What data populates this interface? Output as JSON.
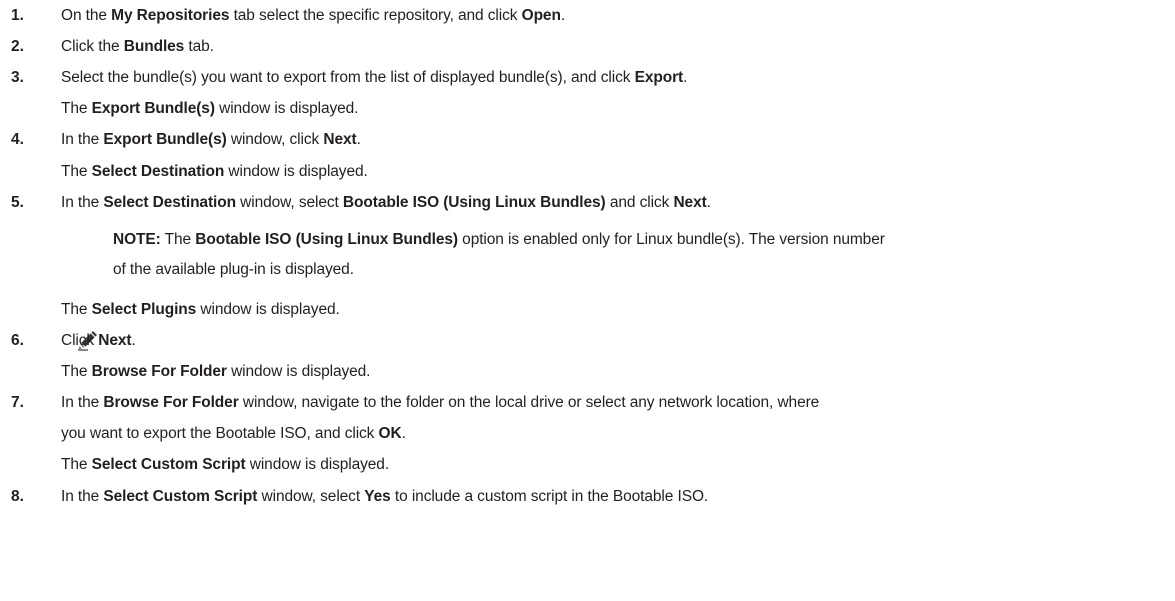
{
  "steps": [
    {
      "num": "1.",
      "lines": [
        [
          {
            "t": "On the "
          },
          {
            "t": "My Repositories",
            "b": true
          },
          {
            "t": " tab select the specific repository, and click "
          },
          {
            "t": "Open",
            "b": true
          },
          {
            "t": "."
          }
        ]
      ]
    },
    {
      "num": "2.",
      "lines": [
        [
          {
            "t": "Click the "
          },
          {
            "t": "Bundles",
            "b": true
          },
          {
            "t": " tab."
          }
        ]
      ]
    },
    {
      "num": "3.",
      "lines": [
        [
          {
            "t": "Select the bundle(s) you want to export from the list of displayed bundle(s), and click "
          },
          {
            "t": "Export",
            "b": true
          },
          {
            "t": "."
          }
        ],
        [
          {
            "t": "The "
          },
          {
            "t": "Export Bundle(s)",
            "b": true
          },
          {
            "t": " window is displayed."
          }
        ]
      ]
    },
    {
      "num": "4.",
      "lines": [
        [
          {
            "t": "In the "
          },
          {
            "t": "Export Bundle(s)",
            "b": true
          },
          {
            "t": " window, click "
          },
          {
            "t": "Next",
            "b": true
          },
          {
            "t": "."
          }
        ],
        [
          {
            "t": "The "
          },
          {
            "t": "Select Destination",
            "b": true
          },
          {
            "t": " window is displayed."
          }
        ]
      ]
    },
    {
      "num": "5.",
      "lines": [
        [
          {
            "t": "In the "
          },
          {
            "t": "Select Destination",
            "b": true
          },
          {
            "t": " window, select "
          },
          {
            "t": "Bootable ISO (Using Linux Bundles)",
            "b": true
          },
          {
            "t": " and click "
          },
          {
            "t": "Next",
            "b": true
          },
          {
            "t": "."
          }
        ]
      ]
    },
    {
      "num": "",
      "note": true,
      "lines": [
        [
          {
            "t": "NOTE:",
            "b": true
          },
          {
            "t": " The "
          },
          {
            "t": "Bootable ISO (Using Linux Bundles)",
            "b": true
          },
          {
            "t": " option is enabled only for Linux bundle(s). The version number"
          }
        ],
        [
          {
            "t": "of the available plug-in is displayed."
          }
        ]
      ]
    },
    {
      "num": "",
      "lines": [
        [
          {
            "t": "The "
          },
          {
            "t": "Select Plugins",
            "b": true
          },
          {
            "t": " window is displayed."
          }
        ]
      ]
    },
    {
      "num": "6.",
      "lines": [
        [
          {
            "t": "Click "
          },
          {
            "t": "Next",
            "b": true
          },
          {
            "t": "."
          }
        ],
        [
          {
            "t": "The "
          },
          {
            "t": "Browse For Folder",
            "b": true
          },
          {
            "t": " window is displayed."
          }
        ]
      ]
    },
    {
      "num": "7.",
      "lines": [
        [
          {
            "t": "In the "
          },
          {
            "t": "Browse For Folder",
            "b": true
          },
          {
            "t": " window, navigate to the folder on the local drive or select any network location, where"
          }
        ],
        [
          {
            "t": "you want to export the Bootable ISO, and click "
          },
          {
            "t": "OK",
            "b": true
          },
          {
            "t": "."
          }
        ],
        [
          {
            "t": "The "
          },
          {
            "t": "Select Custom Script",
            "b": true
          },
          {
            "t": " window is displayed."
          }
        ]
      ]
    },
    {
      "num": "8.",
      "lines": [
        [
          {
            "t": "In the "
          },
          {
            "t": "Select Custom Script",
            "b": true
          },
          {
            "t": " window, select "
          },
          {
            "t": "Yes",
            "b": true
          },
          {
            "t": " to include a custom script in the Bootable ISO."
          }
        ]
      ]
    }
  ],
  "icons": {
    "note": "note-pencil-icon"
  }
}
